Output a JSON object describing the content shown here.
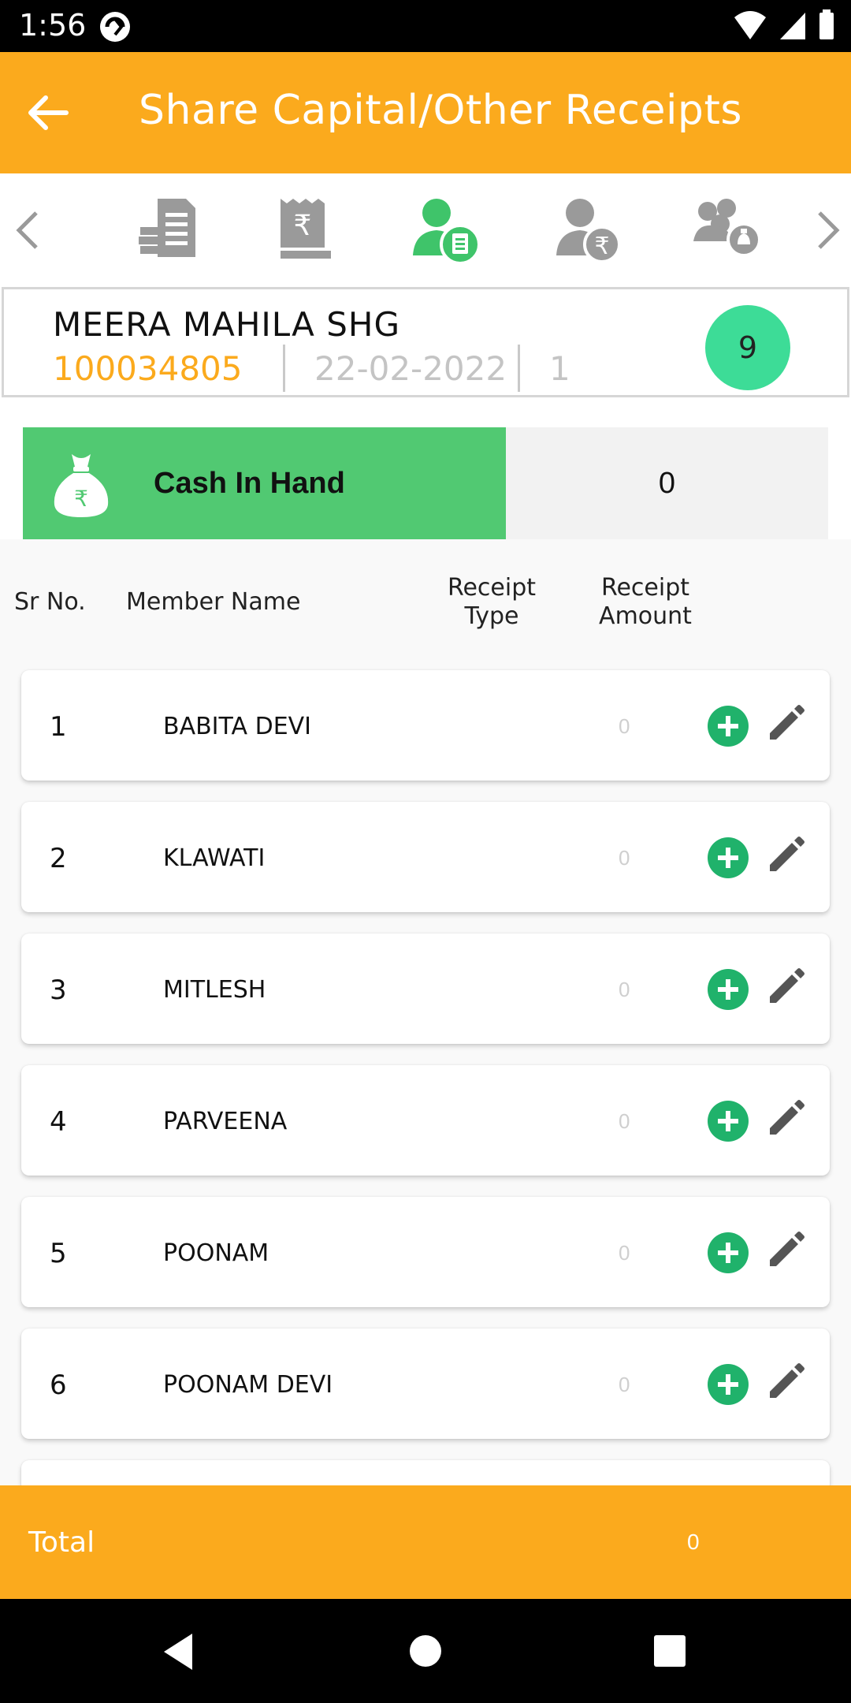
{
  "status_bar": {
    "time": "1:56"
  },
  "header": {
    "title": "Share Capital/Other Receipts"
  },
  "tabs": [
    {
      "icon": "document-list-icon"
    },
    {
      "icon": "rupee-receipt-icon"
    },
    {
      "icon": "member-clipboard-icon",
      "active": true
    },
    {
      "icon": "member-rupee-icon"
    },
    {
      "icon": "group-money-bag-icon"
    }
  ],
  "shg": {
    "name": "MEERA MAHILA SHG",
    "id": "100034805",
    "date": "22-02-2022",
    "number": "1",
    "badge": "9"
  },
  "cash_in_hand": {
    "label": "Cash In Hand",
    "value": "0"
  },
  "columns": {
    "sr_no": "Sr No.",
    "member_name": "Member Name",
    "receipt_type_1": "Receipt",
    "receipt_type_2": "Type",
    "receipt_amount_1": "Receipt",
    "receipt_amount_2": "Amount"
  },
  "members": [
    {
      "sr": "1",
      "name": "BABITA DEVI",
      "amount": "0"
    },
    {
      "sr": "2",
      "name": "KLAWATI",
      "amount": "0"
    },
    {
      "sr": "3",
      "name": "MITLESH",
      "amount": "0"
    },
    {
      "sr": "4",
      "name": "PARVEENA",
      "amount": "0"
    },
    {
      "sr": "5",
      "name": "POONAM",
      "amount": "0"
    },
    {
      "sr": "6",
      "name": "POONAM DEVI",
      "amount": "0"
    }
  ],
  "total": {
    "label": "Total",
    "value": "0"
  },
  "colors": {
    "primary": "#FBAA1D",
    "cash_green": "#51C972",
    "badge_green": "#3DDC97",
    "add_green": "#20B26B",
    "active_tab": "#3FC46A",
    "inactive_tab": "#9a9a9a"
  }
}
